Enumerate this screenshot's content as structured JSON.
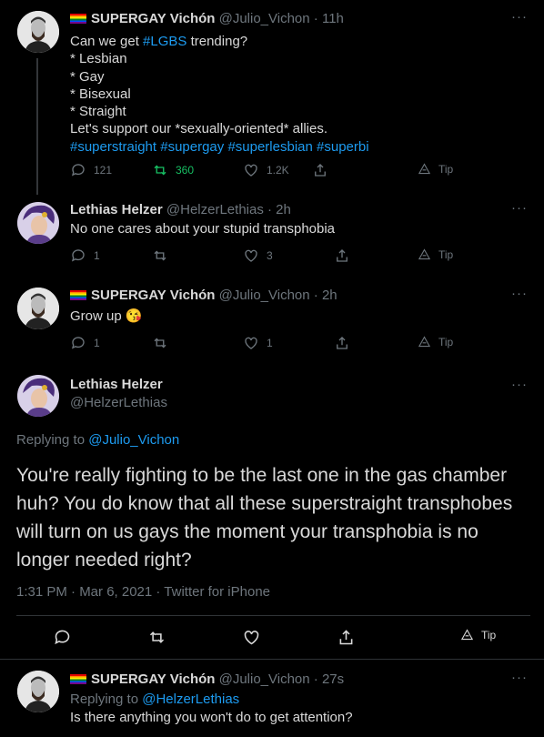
{
  "tweets": [
    {
      "name": "SUPERGAY Vichón",
      "handle": "@Julio_Vichon",
      "time": "· 11h",
      "more": "···",
      "lines": [
        "Can we get #LGBS trending?",
        "* Lesbian",
        "* Gay",
        "* Bisexual",
        "* Straight",
        "Let's support our *sexually-oriented* allies."
      ],
      "hashtag_inline": "#LGBS",
      "hashtags": "#superstraight #supergay #superlesbian #superbi",
      "replies": "121",
      "retweets": "360",
      "likes": "1.2K",
      "tip": "Tip"
    },
    {
      "name": "Lethias Helzer",
      "handle": "@HelzerLethias",
      "time": "· 2h",
      "more": "···",
      "text": "No one cares about your stupid transphobia",
      "replies": "1",
      "retweets": "",
      "likes": "3",
      "tip": "Tip"
    },
    {
      "name": "SUPERGAY Vichón",
      "handle": "@Julio_Vichon",
      "time": "· 2h",
      "more": "···",
      "text": "Grow up 😘",
      "replies": "1",
      "retweets": "",
      "likes": "1",
      "tip": "Tip"
    },
    {
      "name": "Lethias Helzer",
      "handle": "@HelzerLethias",
      "more": "···",
      "replying_prefix": "Replying to",
      "replying_to": "@Julio_Vichon",
      "text": "You're really fighting to be the last one in the gas chamber huh? You do know that all these superstraight transphobes will turn on us gays the moment your transphobia is no longer needed right?",
      "meta": "1:31 PM · Mar 6, 2021 · Twitter for iPhone",
      "tip": "Tip"
    },
    {
      "name": "SUPERGAY Vichón",
      "handle": "@Julio_Vichon",
      "time": "· 27s",
      "more": "···",
      "replying_prefix": "Replying to",
      "replying_to": "@HelzerLethias",
      "text": "Is there anything you won't do to get attention?"
    }
  ]
}
